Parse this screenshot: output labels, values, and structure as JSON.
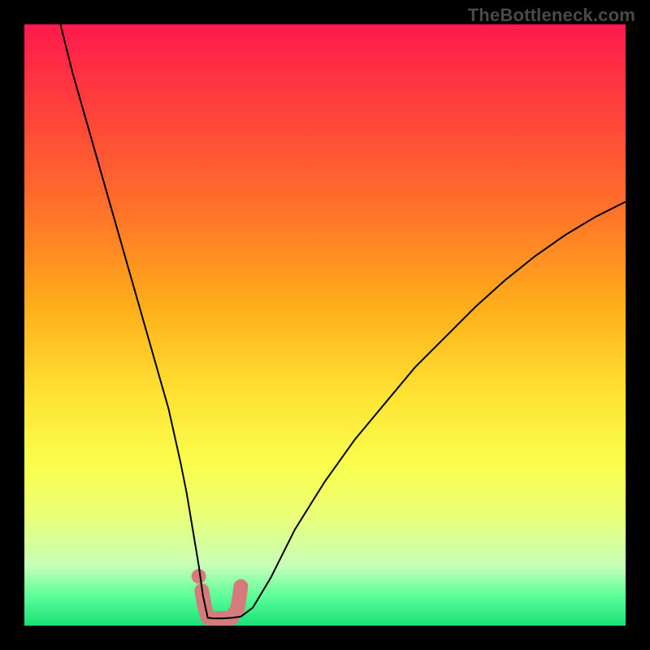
{
  "watermark": "TheBottleneck.com",
  "chart_data": {
    "type": "line",
    "title": "",
    "xlabel": "",
    "ylabel": "",
    "xlim": [
      0,
      100
    ],
    "ylim": [
      0,
      100
    ],
    "grid": false,
    "series": [
      {
        "name": "bottleneck-curve",
        "color": "#000000",
        "stroke_width": 2,
        "x": [
          6,
          8,
          10,
          12,
          14,
          16,
          18,
          20,
          22,
          24,
          26,
          27,
          28,
          29,
          29.7,
          30.5,
          31.5,
          33,
          34.5,
          36,
          38,
          41,
          45,
          50,
          55,
          60,
          65,
          70,
          75,
          80,
          85,
          90,
          95,
          100
        ],
        "values": [
          100,
          92,
          85,
          78,
          71,
          64,
          57,
          50,
          43,
          36,
          27,
          22,
          16,
          10,
          5,
          1.3,
          1.2,
          1.2,
          1.3,
          1.5,
          3,
          8,
          16,
          24,
          31,
          37,
          43,
          48,
          53,
          57.5,
          61.5,
          65,
          68,
          70.5
        ]
      },
      {
        "name": "optimal-region-marker",
        "color": "#d67b7b",
        "stroke_width": 18,
        "linecap": "round",
        "x": [
          29.5,
          30,
          30.5,
          31.5,
          33,
          34.5,
          35.5,
          36
        ],
        "values": [
          5.8,
          3,
          1.3,
          1.2,
          1.2,
          1.3,
          3,
          6.5
        ]
      }
    ],
    "points": [
      {
        "name": "marker-dot",
        "x": 29.0,
        "y": 8.2,
        "r": 9,
        "color": "#d67b7b"
      }
    ]
  }
}
